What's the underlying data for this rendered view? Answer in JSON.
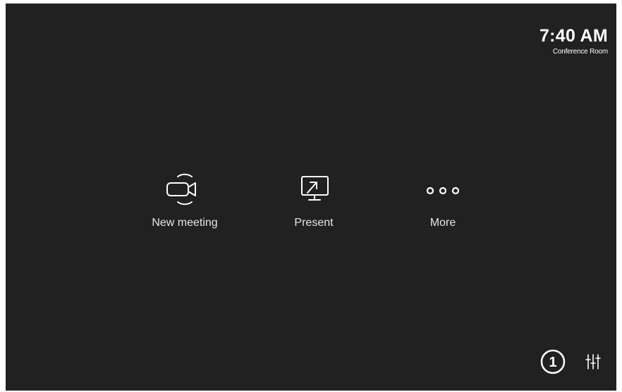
{
  "status": {
    "time": "7:40 AM",
    "room_name": "Conference Room"
  },
  "actions": [
    {
      "label": "New meeting",
      "icon": "video-camera-icon"
    },
    {
      "label": "Present",
      "icon": "present-screen-icon"
    },
    {
      "label": "More",
      "icon": "more-dots-icon"
    }
  ],
  "footer": {
    "notification_count": "1",
    "settings_icon": "sliders-icon"
  },
  "colors": {
    "background": "#212121",
    "foreground": "#ffffff"
  }
}
